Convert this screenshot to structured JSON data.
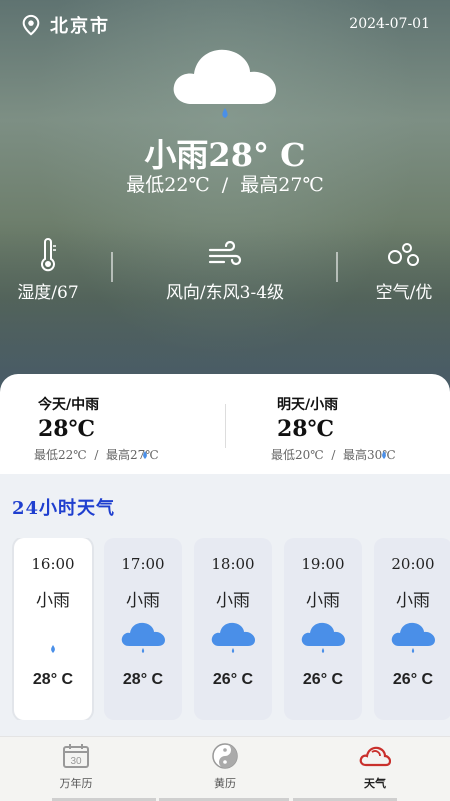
{
  "header": {
    "city": "北京市",
    "date": "2024-07-01"
  },
  "current": {
    "summary": "小雨28° C",
    "range": "最低22℃  /  最高27℃"
  },
  "stats": [
    {
      "icon": "thermometer-icon",
      "label": "湿度/67"
    },
    {
      "icon": "wind-icon",
      "label": "风向/东风3-4级"
    },
    {
      "icon": "air-quality-icon",
      "label": "空气/优"
    }
  ],
  "forecast": [
    {
      "title": "今天/中雨",
      "temp": "28℃",
      "range": "最低22℃  /  最高27℃"
    },
    {
      "title": "明天/小雨",
      "temp": "28℃",
      "range": "最低20℃  /  最高30℃"
    }
  ],
  "hourly_title": "24小时天气",
  "hourly": [
    {
      "time": "16:00",
      "weather": "小雨",
      "icon": "raindrop-icon",
      "temp": "28° C",
      "selected": true
    },
    {
      "time": "17:00",
      "weather": "小雨",
      "icon": "rain-cloud-icon",
      "temp": "28° C"
    },
    {
      "time": "18:00",
      "weather": "小雨",
      "icon": "rain-cloud-icon",
      "temp": "26° C"
    },
    {
      "time": "19:00",
      "weather": "小雨",
      "icon": "rain-cloud-icon",
      "temp": "26° C"
    },
    {
      "time": "20:00",
      "weather": "小雨",
      "icon": "rain-cloud-icon",
      "temp": "26° C"
    }
  ],
  "tabs": [
    {
      "label": "万年历",
      "icon": "calendar-icon",
      "badge": "30"
    },
    {
      "label": "黄历",
      "icon": "yin-yang-icon"
    },
    {
      "label": "天气",
      "icon": "weather-cloud-icon",
      "active": true
    }
  ],
  "colors": {
    "accent_blue": "#1f3fcf",
    "rain_blue": "#4a8fe8",
    "tab_active_red": "#c9302c"
  }
}
